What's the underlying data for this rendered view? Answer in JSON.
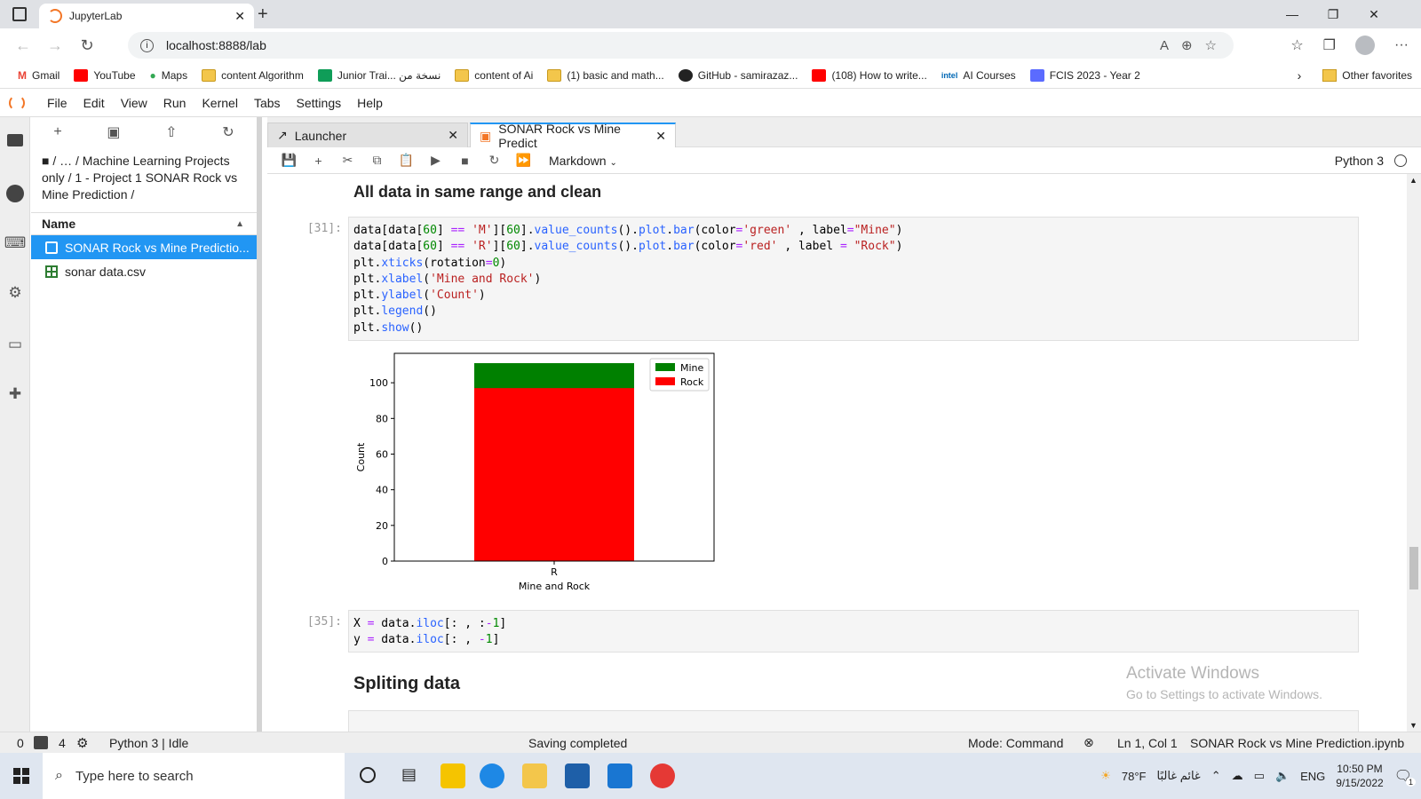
{
  "browser": {
    "tab_title": "JupyterLab",
    "url": "localhost:8888/lab",
    "bookmarks": [
      "Gmail",
      "YouTube",
      "Maps",
      "content Algorithm",
      "Junior Trai... نسخة من",
      "content of Ai",
      "(1) basic and math...",
      "GitHub - samirazaz...",
      "(108) How to write...",
      "AI Courses",
      "FCIS 2023 - Year 2"
    ],
    "other_favorites": "Other favorites",
    "intel_label": "intel"
  },
  "menu": [
    "File",
    "Edit",
    "View",
    "Run",
    "Kernel",
    "Tabs",
    "Settings",
    "Help"
  ],
  "filebrowser": {
    "breadcrumb": "/ … / Machine Learning Projects only / 1 - Project 1 SONAR Rock vs Mine Prediction /",
    "header": "Name",
    "items": [
      "SONAR Rock vs Mine Predictio...",
      "sonar data.csv"
    ]
  },
  "tabs": {
    "launcher": "Launcher",
    "notebook": "SONAR Rock vs Mine Predict"
  },
  "toolbar": {
    "cell_type": "Markdown",
    "kernel": "Python 3"
  },
  "notebook": {
    "heading1": "All data in same range and clean",
    "cell31_prompt": "[31]:",
    "cell31_lines": [
      "data[data[60] == 'M'][60].value_counts().plot.bar(color='green' , label=\"Mine\")",
      "data[data[60] == 'R'][60].value_counts().plot.bar(color='red' , label = \"Rock\")",
      "plt.xticks(rotation=0)",
      "plt.xlabel('Mine and Rock')",
      "plt.ylabel('Count')",
      "plt.legend()",
      "plt.show()"
    ],
    "cell35_prompt": "[35]:",
    "cell35_lines": [
      "X = data.iloc[: , :-1]",
      "y = data.iloc[: , -1]"
    ],
    "heading2": "Spliting data"
  },
  "chart_data": {
    "type": "bar",
    "categories": [
      "R"
    ],
    "series": [
      {
        "name": "Mine",
        "values": [
          111
        ],
        "color": "#008000"
      },
      {
        "name": "Rock",
        "values": [
          97
        ],
        "color": "#ff0000"
      }
    ],
    "title": "",
    "xlabel": "Mine and Rock",
    "ylabel": "Count",
    "ylim": [
      0,
      116.5
    ],
    "yticks": [
      0,
      20,
      40,
      60,
      80,
      100
    ],
    "legend": "top-right"
  },
  "watermark": {
    "line1": "Activate Windows",
    "line2": "Go to Settings to activate Windows."
  },
  "status": {
    "zero": "0",
    "four": "4",
    "kernel_state": "Python 3 | Idle",
    "saving": "Saving completed",
    "mode": "Mode: Command",
    "cursor": "Ln 1, Col 1",
    "filename": "SONAR Rock vs Mine Prediction.ipynb"
  },
  "taskbar": {
    "search_placeholder": "Type here to search",
    "temp": "78°F",
    "weather": "غائم غالبًا",
    "lang": "ENG",
    "time": "10:50 PM",
    "date": "9/15/2022",
    "notif": "1"
  }
}
